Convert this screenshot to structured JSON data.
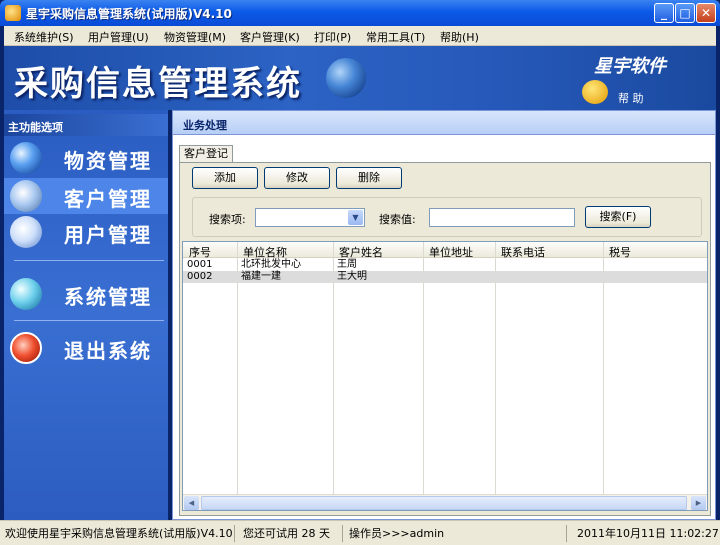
{
  "window": {
    "title": "星宇采购信息管理系统(试用版)V4.10",
    "min_label": "_",
    "max_label": "□",
    "close_label": "✕"
  },
  "menu": [
    {
      "label": "系统维护(S)"
    },
    {
      "label": "用户管理(U)"
    },
    {
      "label": "物资管理(M)"
    },
    {
      "label": "客户管理(K)"
    },
    {
      "label": "打印(P)"
    },
    {
      "label": "常用工具(T)"
    },
    {
      "label": "帮助(H)"
    }
  ],
  "banner": {
    "title": "采购信息管理系统",
    "brand": "星宇软件",
    "help_label": "帮 助"
  },
  "sidebar": {
    "header": "主功能选项",
    "items": [
      {
        "label": "物资管理",
        "icon": "globe-icon",
        "active": false
      },
      {
        "label": "客户管理",
        "icon": "customer-icon",
        "active": true
      },
      {
        "label": "用户管理",
        "icon": "users-icon",
        "active": false
      },
      {
        "label": "系统管理",
        "icon": "system-icon",
        "active": false
      },
      {
        "label": "退出系统",
        "icon": "power-icon",
        "active": false
      }
    ]
  },
  "main": {
    "title": "业务处理",
    "tab_label": "客户登记",
    "buttons": {
      "add": "添加",
      "edit": "修改",
      "delete": "删除",
      "search": "搜索(F)"
    },
    "search": {
      "field_label": "搜索项:",
      "field_value": "",
      "value_label": "搜索值:",
      "value_text": ""
    },
    "table": {
      "columns": [
        "序号",
        "单位名称",
        "客户姓名",
        "单位地址",
        "联系电话",
        "税号"
      ],
      "rows": [
        [
          "0001",
          "北环批发中心",
          "王周",
          "",
          "",
          ""
        ],
        [
          "0002",
          "福建一建",
          "王大明",
          "",
          "",
          ""
        ]
      ],
      "selected_row": 1
    }
  },
  "status": {
    "welcome": "欢迎使用星宇采购信息管理系统(试用版)V4.10",
    "trial": "您还可试用 28 天",
    "operator": "操作员>>>admin",
    "datetime": "2011年10月11日 11:02:27"
  },
  "colors": {
    "title_bar": "#0c5ae8",
    "banner": "#2c63c4",
    "sidebar": "#3a6fd2",
    "sidebar_active": "#4d86e8",
    "panel": "#ece9d8"
  }
}
